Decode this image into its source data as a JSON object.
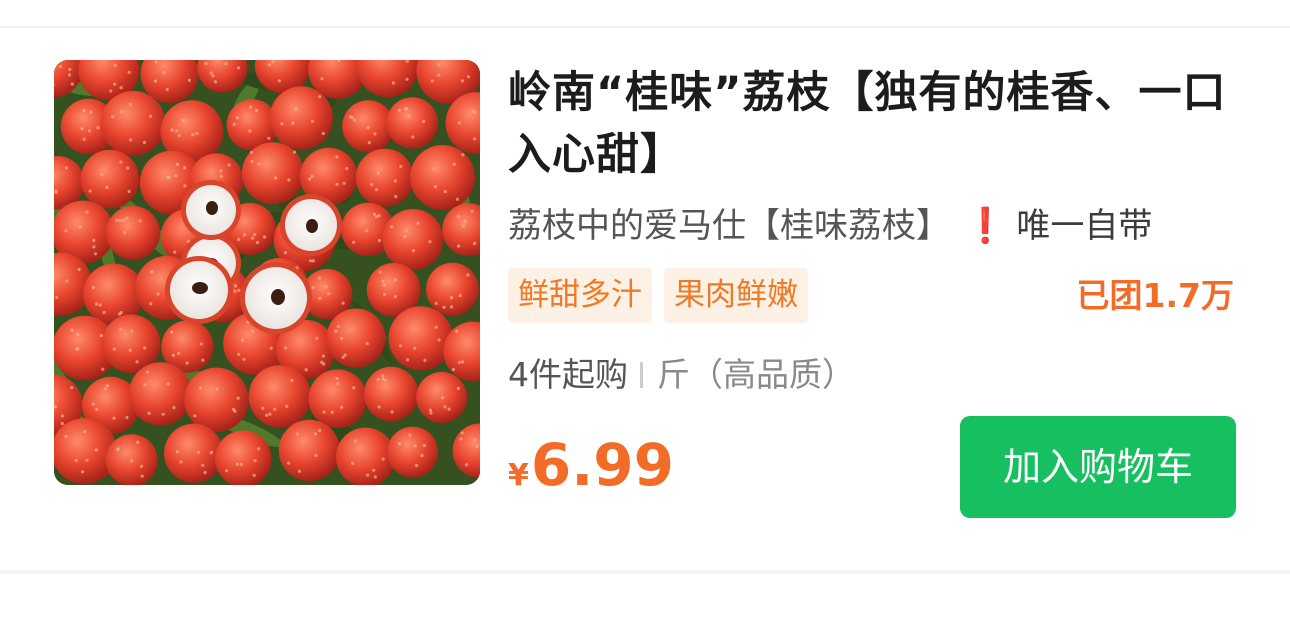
{
  "product": {
    "title": "岭南“桂味”荔枝【独有的桂香、一口入心甜】",
    "subtitle": "荔枝中的爱马仕【桂味荔枝】",
    "subtitle_tail": "唯一自带",
    "alert_icon": "❗",
    "tags": [
      "鲜甜多汁",
      "果肉鲜嫩"
    ],
    "group_count": "已团1.7万",
    "min_purchase": "4件起购",
    "spec": "斤（高品质）",
    "price_currency": "¥",
    "price": "6.99",
    "add_to_cart_label": "加入购物车",
    "image_icon": "lychee-photo"
  },
  "colors": {
    "accent_orange": "#f26b27",
    "tag_bg": "#fdf1e6",
    "button_green": "#16c060",
    "alert_red": "#e02424"
  }
}
